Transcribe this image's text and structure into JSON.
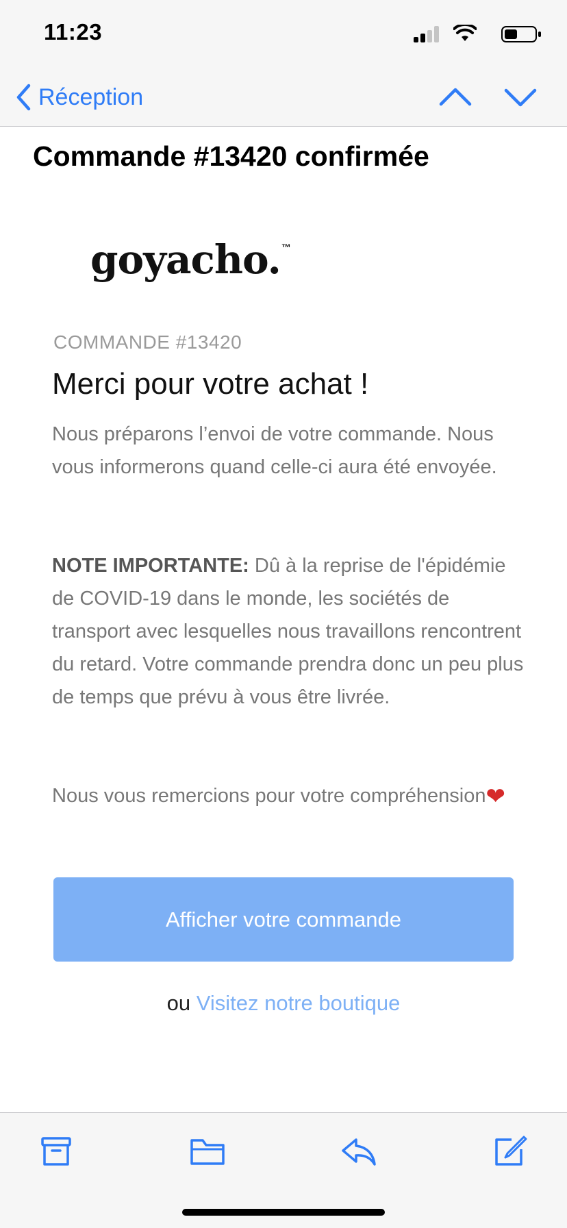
{
  "status_bar": {
    "time": "11:23",
    "icons": [
      "signal-icon",
      "wifi-icon",
      "battery-icon"
    ]
  },
  "nav": {
    "back_label": "Réception",
    "icons": [
      "chevron-left-icon",
      "chevron-up-icon",
      "chevron-down-icon"
    ],
    "accent_color": "#2f7cf6"
  },
  "email": {
    "subject": "Commande #13420 confirmée",
    "logo_text": "goyacho.",
    "logo_mark": "™",
    "order_label": "COMMANDE #13420",
    "heading": "Merci pour votre achat !",
    "paragraph1": "Nous préparons l’envoi de votre commande. Nous vous informerons quand celle-ci aura été envoyée.",
    "note_label": "NOTE IMPORTANTE:",
    "note_text": " Dû à la reprise de l'épidémie de COVID-19 dans le monde, les sociétés de transport avec lesquelles nous travaillons rencontrent du retard. Votre commande prendra donc un peu plus de temps que prévu à vous être livrée.",
    "closing_text": "Nous vous remercions pour votre compréhension",
    "closing_emoji": "❤",
    "button_label": "Afficher votre commande",
    "button_color": "#7db0f5",
    "or_text": "ou ",
    "store_link": "Visitez notre boutique"
  },
  "toolbar": {
    "icons": [
      "archive-icon",
      "folder-icon",
      "reply-icon",
      "compose-icon"
    ]
  }
}
